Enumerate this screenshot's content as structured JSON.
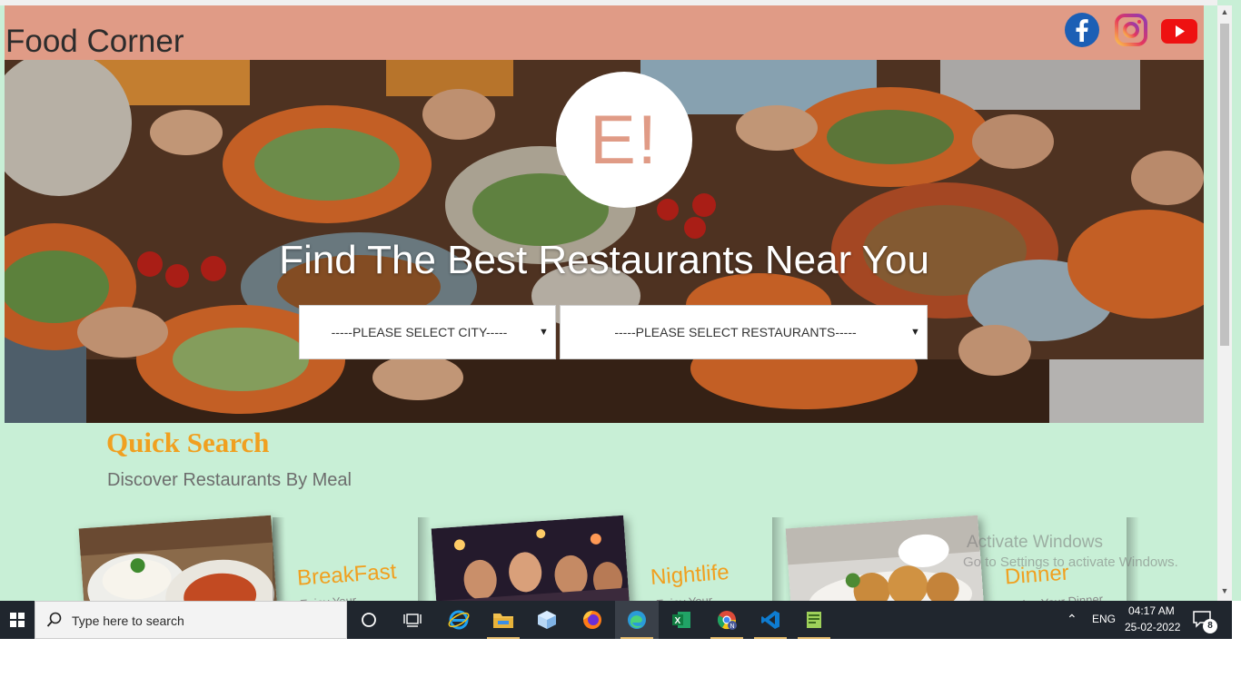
{
  "header": {
    "title": "Food Corner",
    "social_icons": [
      "facebook-icon",
      "instagram-icon",
      "youtube-icon"
    ]
  },
  "hero": {
    "logo": "E!",
    "title": "Find The Best Restaurants Near You",
    "city_select": {
      "selected": "-----PLEASE SELECT CITY-----"
    },
    "restaurant_select": {
      "selected": "-----PLEASE SELECT RESTAURANTS-----"
    }
  },
  "quick_search": {
    "title": "Quick Search",
    "subtitle": "Discover Restaurants By Meal",
    "cards": [
      {
        "title": "BreakFast",
        "desc": "Enjoy Your"
      },
      {
        "title": "Nightlife",
        "desc": "Enjoy Your"
      },
      {
        "title": "Dinner",
        "desc": "Enjoy Your Dinner"
      }
    ]
  },
  "watermark": {
    "line1": "Activate Windows",
    "line2": "Go to Settings to activate Windows."
  },
  "taskbar": {
    "search_placeholder": "Type here to search",
    "language": "ENG",
    "time": "04:17 AM",
    "date": "25-02-2022",
    "notification_count": "8"
  },
  "colors": {
    "header_bg": "#e09b86",
    "page_bg": "#c8efd6",
    "accent": "#f0a020",
    "taskbar_bg": "#20262e"
  }
}
